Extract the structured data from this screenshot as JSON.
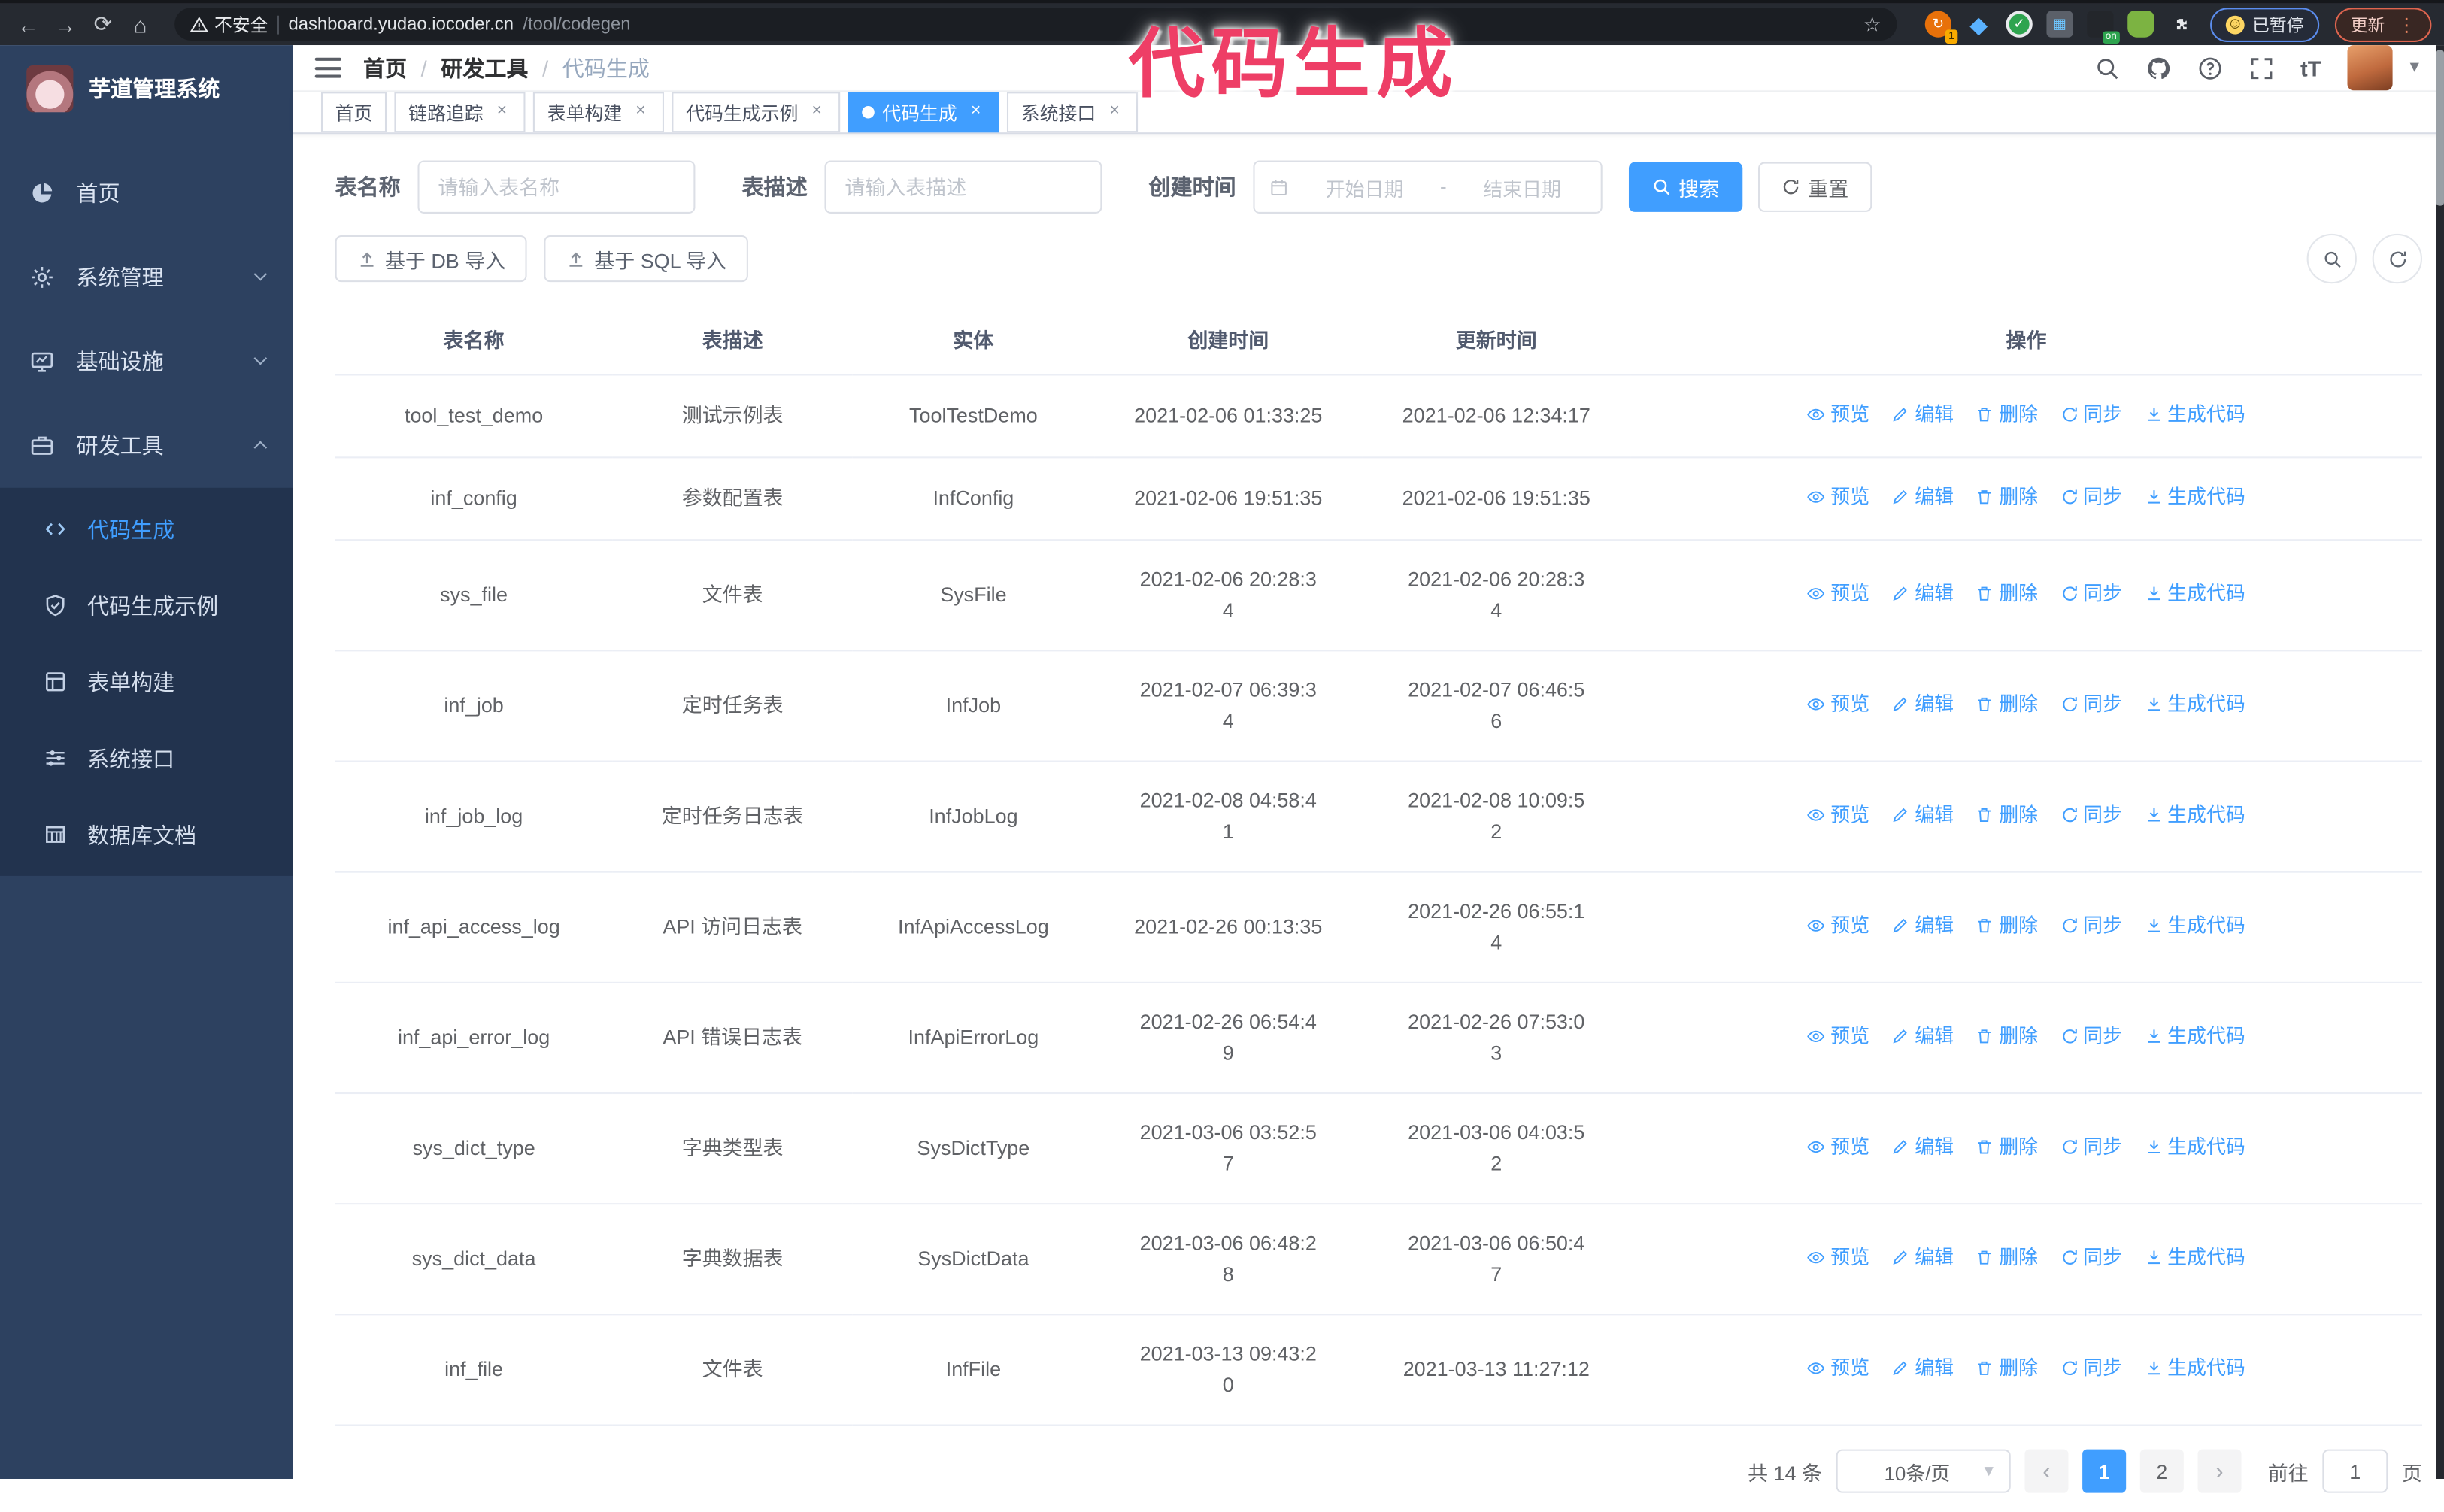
{
  "browser": {
    "security_label": "不安全",
    "url_host": "dashboard.yudao.iocoder.cn",
    "url_path": "/tool/codegen",
    "ext_badge": "1",
    "ext_on_label": "on",
    "paused_label": "已暂停",
    "update_label": "更新"
  },
  "watermark": "代码生成",
  "colors": {
    "accent": "#409eff",
    "watermark_pink": "#ee3e66",
    "sidebar_bg": "#2d4160",
    "submenu_bg": "#22334e"
  },
  "sidebar": {
    "title": "芋道管理系统",
    "items": [
      {
        "key": "home",
        "label": "首页",
        "icon": "dashboard-icon"
      },
      {
        "key": "system-manage",
        "label": "系统管理",
        "icon": "gear-icon",
        "chevron": "down"
      },
      {
        "key": "infrastructure",
        "label": "基础设施",
        "icon": "monitor-icon",
        "chevron": "down"
      },
      {
        "key": "dev-tools",
        "label": "研发工具",
        "icon": "briefcase-icon",
        "chevron": "up",
        "expanded": true
      }
    ],
    "submenu": [
      {
        "key": "codegen",
        "label": "代码生成",
        "icon": "code-icon",
        "active": true
      },
      {
        "key": "codegen-example",
        "label": "代码生成示例",
        "icon": "shield-check-icon"
      },
      {
        "key": "form-builder",
        "label": "表单构建",
        "icon": "form-icon"
      },
      {
        "key": "system-api",
        "label": "系统接口",
        "icon": "sliders-icon"
      },
      {
        "key": "db-doc",
        "label": "数据库文档",
        "icon": "database-icon"
      }
    ]
  },
  "navbar": {
    "breadcrumb": [
      "首页",
      "研发工具",
      "代码生成"
    ],
    "icons": [
      "search-icon",
      "github-icon",
      "help-icon",
      "fullscreen-icon",
      "font-size-icon"
    ],
    "font_size_glyph": "tT"
  },
  "tabs": [
    {
      "key": "home",
      "label": "首页",
      "closable": false,
      "active": false
    },
    {
      "key": "trace",
      "label": "链路追踪",
      "closable": true,
      "active": false
    },
    {
      "key": "form-builder",
      "label": "表单构建",
      "closable": true,
      "active": false
    },
    {
      "key": "codegen-example",
      "label": "代码生成示例",
      "closable": true,
      "active": false
    },
    {
      "key": "codegen",
      "label": "代码生成",
      "closable": true,
      "active": true
    },
    {
      "key": "system-api",
      "label": "系统接口",
      "closable": true,
      "active": false
    }
  ],
  "search_form": {
    "fields": [
      {
        "label": "表名称",
        "placeholder": "请输入表名称",
        "value": ""
      },
      {
        "label": "表描述",
        "placeholder": "请输入表描述",
        "value": ""
      }
    ],
    "date_field": {
      "label": "创建时间",
      "start_placeholder": "开始日期",
      "separator": "-",
      "end_placeholder": "结束日期"
    },
    "search_label": "搜索",
    "reset_label": "重置"
  },
  "toolbar": {
    "import_db": "基于 DB 导入",
    "import_sql": "基于 SQL 导入"
  },
  "table": {
    "columns": [
      "表名称",
      "表描述",
      "实体",
      "创建时间",
      "更新时间",
      "操作"
    ],
    "actions": [
      {
        "key": "preview",
        "label": "预览",
        "icon": "eye-icon"
      },
      {
        "key": "edit",
        "label": "编辑",
        "icon": "edit-icon"
      },
      {
        "key": "delete",
        "label": "删除",
        "icon": "delete-icon"
      },
      {
        "key": "sync",
        "label": "同步",
        "icon": "sync-icon"
      },
      {
        "key": "generate",
        "label": "生成代码",
        "icon": "download-icon"
      }
    ],
    "rows": [
      {
        "name": "tool_test_demo",
        "desc": "测试示例表",
        "entity": "ToolTestDemo",
        "created": "2021-02-06 01:33:25",
        "updated": "2021-02-06 12:34:17",
        "created_wrap": false,
        "updated_wrap": false
      },
      {
        "name": "inf_config",
        "desc": "参数配置表",
        "entity": "InfConfig",
        "created": "2021-02-06 19:51:35",
        "updated": "2021-02-06 19:51:35",
        "created_wrap": false,
        "updated_wrap": false
      },
      {
        "name": "sys_file",
        "desc": "文件表",
        "entity": "SysFile",
        "created": "2021-02-06 20:28:34",
        "updated": "2021-02-06 20:28:34",
        "created_wrap": true,
        "updated_wrap": true
      },
      {
        "name": "inf_job",
        "desc": "定时任务表",
        "entity": "InfJob",
        "created": "2021-02-07 06:39:34",
        "updated": "2021-02-07 06:46:56",
        "created_wrap": true,
        "updated_wrap": true
      },
      {
        "name": "inf_job_log",
        "desc": "定时任务日志表",
        "entity": "InfJobLog",
        "created": "2021-02-08 04:58:41",
        "updated": "2021-02-08 10:09:52",
        "created_wrap": true,
        "updated_wrap": true
      },
      {
        "name": "inf_api_access_log",
        "desc": "API 访问日志表",
        "entity": "InfApiAccessLog",
        "created": "2021-02-26 00:13:35",
        "updated": "2021-02-26 06:55:14",
        "created_wrap": false,
        "updated_wrap": true
      },
      {
        "name": "inf_api_error_log",
        "desc": "API 错误日志表",
        "entity": "InfApiErrorLog",
        "created": "2021-02-26 06:54:49",
        "updated": "2021-02-26 07:53:03",
        "created_wrap": true,
        "updated_wrap": true
      },
      {
        "name": "sys_dict_type",
        "desc": "字典类型表",
        "entity": "SysDictType",
        "created": "2021-03-06 03:52:57",
        "updated": "2021-03-06 04:03:52",
        "created_wrap": true,
        "updated_wrap": true
      },
      {
        "name": "sys_dict_data",
        "desc": "字典数据表",
        "entity": "SysDictData",
        "created": "2021-03-06 06:48:28",
        "updated": "2021-03-06 06:50:47",
        "created_wrap": true,
        "updated_wrap": true
      },
      {
        "name": "inf_file",
        "desc": "文件表",
        "entity": "InfFile",
        "created": "2021-03-13 09:43:20",
        "updated": "2021-03-13 11:27:12",
        "created_wrap": true,
        "updated_wrap": false
      }
    ]
  },
  "pagination": {
    "total_label": "共 14 条",
    "page_size": "10条/页",
    "pages": [
      "1",
      "2"
    ],
    "active_page": "1",
    "goto_label": "前往",
    "goto_value": "1",
    "page_suffix": "页"
  }
}
